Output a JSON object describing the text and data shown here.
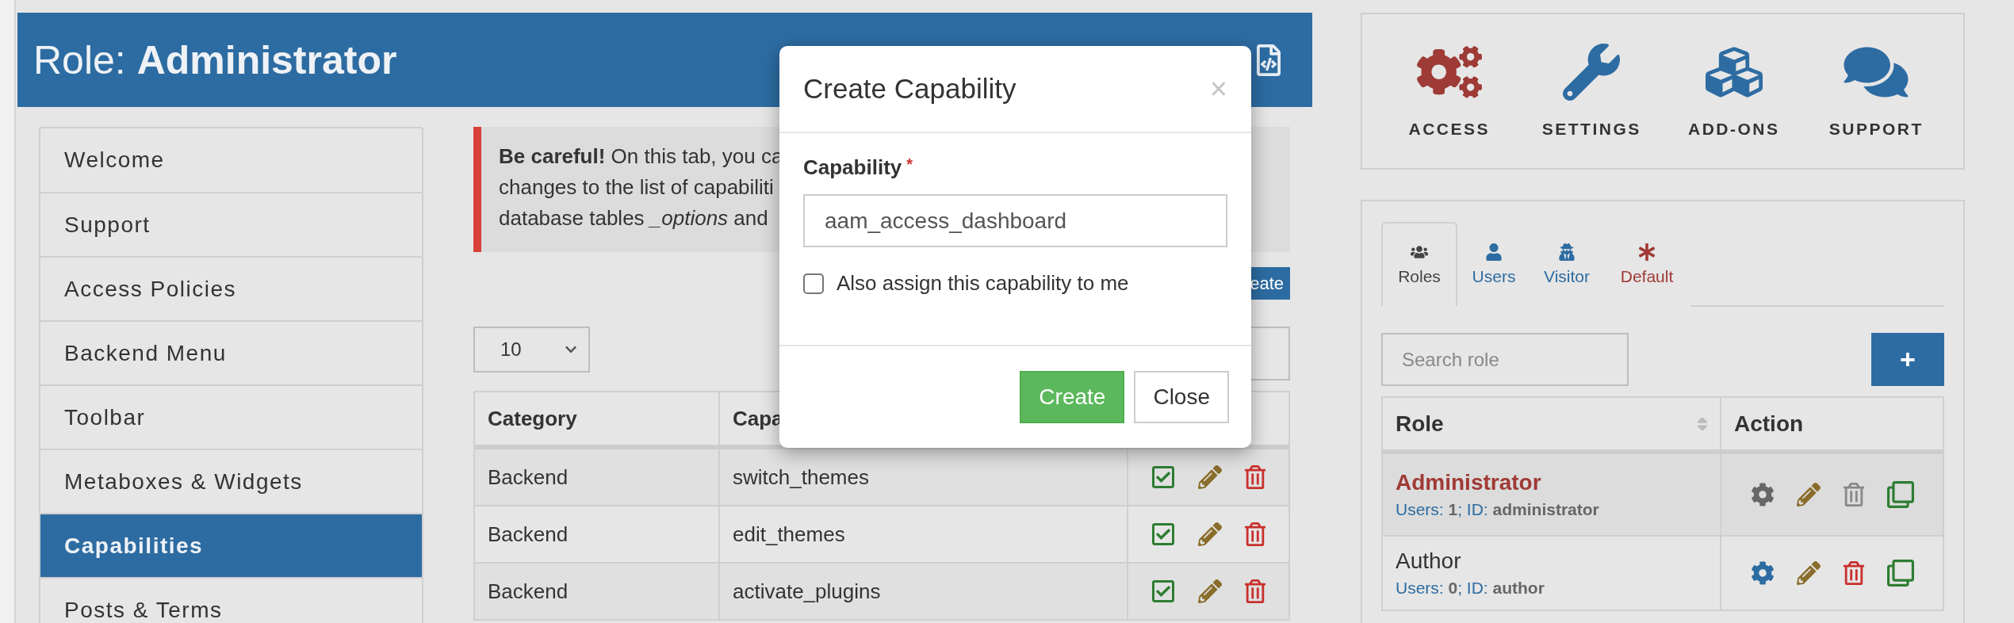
{
  "header": {
    "title": "Role: **Administrator**"
  },
  "sidebar": {
    "items": [
      {
        "label": "Welcome",
        "selected": false
      },
      {
        "label": "Support",
        "selected": false
      },
      {
        "label": "Access Policies",
        "selected": false
      },
      {
        "label": "Backend Menu",
        "selected": false
      },
      {
        "label": "Toolbar",
        "selected": false
      },
      {
        "label": "Metaboxes & Widgets",
        "selected": false
      },
      {
        "label": "Capabilities",
        "selected": true
      },
      {
        "label": "Posts & Terms",
        "selected": false
      }
    ]
  },
  "alert": {
    "lines": [
      "**Be careful!** On this tab, you ca",
      "changes to the list of capabiliti",
      "database tables *_options* and"
    ]
  },
  "create_button": {
    "label": "eate"
  },
  "page_size": {
    "value": "10"
  },
  "capabilities_table": {
    "columns": [
      "Category",
      "Capa"
    ],
    "rows": [
      {
        "category": "Backend",
        "capability": "switch_themes",
        "granted": true
      },
      {
        "category": "Backend",
        "capability": "edit_themes",
        "granted": true
      },
      {
        "category": "Backend",
        "capability": "activate_plugins",
        "granted": true
      }
    ]
  },
  "modal": {
    "title": "Create Capability",
    "close": "×",
    "field_label": "Capability",
    "required_mark": "*",
    "value": "aam_access_dashboard",
    "checkbox": {
      "label": "Also assign this capability to me",
      "checked": false
    },
    "buttons": [
      {
        "label": "Create",
        "kind": "primary"
      },
      {
        "label": "Close",
        "kind": "default"
      }
    ]
  },
  "nav": [
    {
      "label": "ACCESS",
      "color": "#9e3b36"
    },
    {
      "label": "SETTINGS",
      "color": "#2d6ca2"
    },
    {
      "label": "ADD-ONS",
      "color": "#2d6ca2"
    },
    {
      "label": "SUPPORT",
      "color": "#2d6ca2"
    }
  ],
  "tabs": [
    {
      "label": "Roles",
      "selected": true
    },
    {
      "label": "Users",
      "selected": false,
      "color": "#2d6ca2"
    },
    {
      "label": "Visitor",
      "selected": false,
      "color": "#2d6ca2"
    },
    {
      "label": "Default",
      "selected": false,
      "color": "#a03a35"
    }
  ],
  "role_search": {
    "placeholder": "Search role"
  },
  "add_button": {
    "label": "+"
  },
  "roles_table": {
    "columns": [
      "Role",
      "Action"
    ],
    "rows": [
      {
        "name": "Administrator",
        "meta": "Users: **1**; ID: **administrator**",
        "selected": true
      },
      {
        "name": "Author",
        "meta": "Users: **0**; ID: **author**",
        "selected": false
      }
    ]
  }
}
